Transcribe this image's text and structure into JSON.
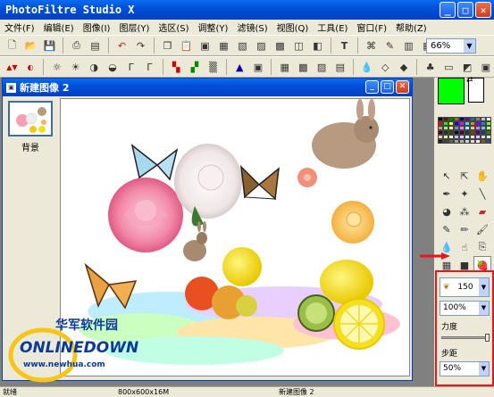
{
  "window": {
    "title": "PhotoFiltre Studio X"
  },
  "menu": [
    "文件(F)",
    "编辑(E)",
    "图像(I)",
    "图层(Y)",
    "选区(S)",
    "调整(Y)",
    "滤镜(S)",
    "视图(Q)",
    "工具(E)",
    "窗口(F)",
    "帮助(Z)"
  ],
  "toolbar": {
    "zoom": "66%"
  },
  "document": {
    "title": "新建图像 2",
    "layer_label": "背景"
  },
  "options": {
    "size_value": "150",
    "opacity_value": "100%",
    "strength_label": "力度",
    "step_label": "步距",
    "step_value": "50%"
  },
  "status": {
    "left": "就绪",
    "size": "800x600x16M",
    "doc": "新建图像 2"
  },
  "watermark": {
    "line1": "华军软件园",
    "line2": "ONLINEDOWN",
    "line3": "www.newhua.com"
  },
  "colors": {
    "foreground": "#00ff00",
    "background": "#ffffff",
    "highlight": "#e8161b",
    "titlebar": "#0050d8"
  }
}
